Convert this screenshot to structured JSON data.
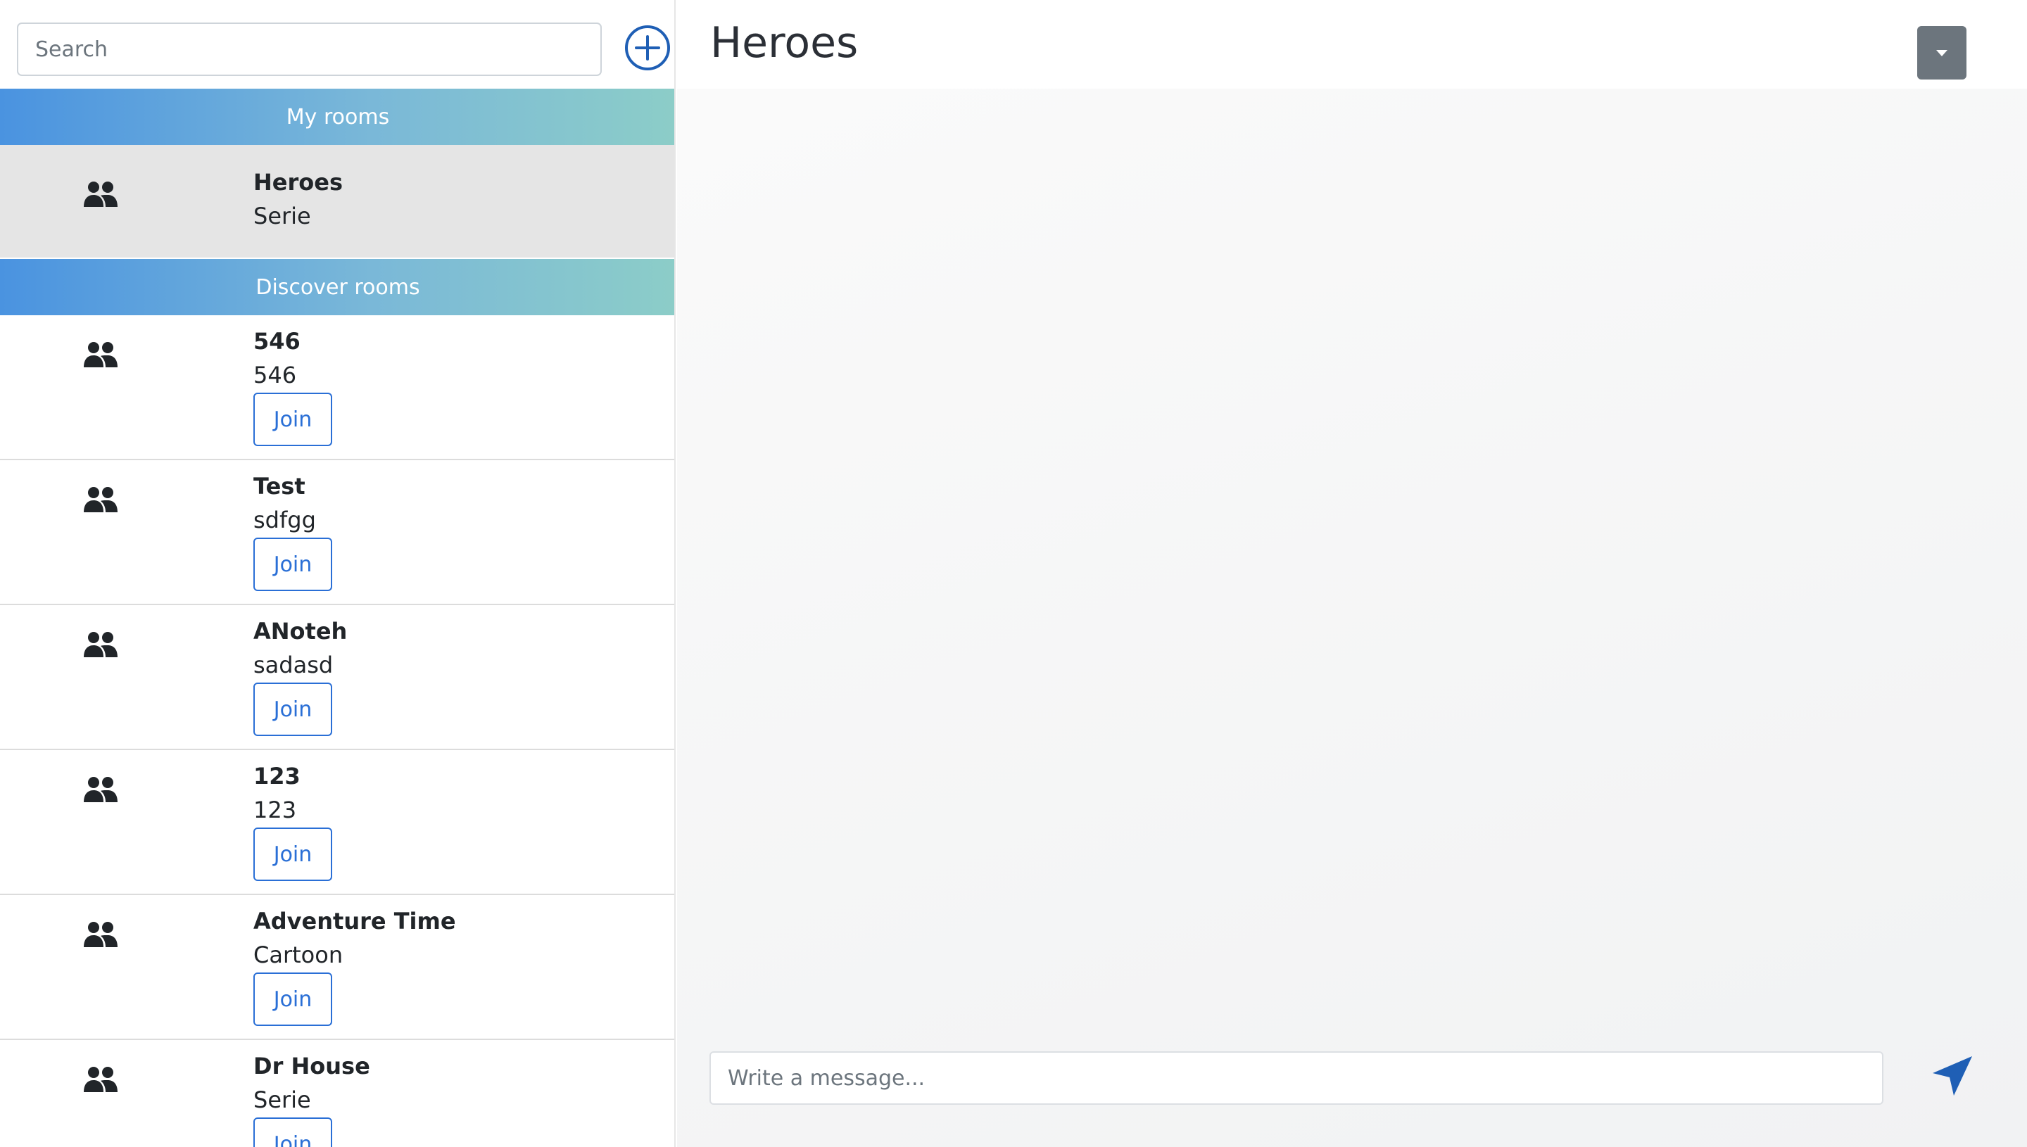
{
  "sidebar": {
    "search": {
      "placeholder": "Search",
      "value": ""
    },
    "add_button_icon": "plus-circle-icon",
    "my_rooms_label": "My rooms",
    "discover_rooms_label": "Discover rooms",
    "my_rooms": [
      {
        "name": "Heroes",
        "description": "Serie",
        "icon": "users-icon",
        "active": true
      }
    ],
    "discover_rooms": [
      {
        "name": "546",
        "description": "546",
        "join_label": "Join",
        "icon": "users-icon"
      },
      {
        "name": "Test",
        "description": "sdfgg",
        "join_label": "Join",
        "icon": "users-icon"
      },
      {
        "name": "ANoteh",
        "description": "sadasd",
        "join_label": "Join",
        "icon": "users-icon"
      },
      {
        "name": "123",
        "description": "123",
        "join_label": "Join",
        "icon": "users-icon"
      },
      {
        "name": "Adventure Time",
        "description": "Cartoon",
        "join_label": "Join",
        "icon": "users-icon"
      },
      {
        "name": "Dr House",
        "description": "Serie",
        "join_label": "Join",
        "icon": "users-icon"
      }
    ]
  },
  "main": {
    "room_title": "Heroes",
    "menu_icon": "caret-down-icon",
    "message_input": {
      "placeholder": "Write a message...",
      "value": ""
    },
    "send_icon": "send-arrow-icon"
  },
  "colors": {
    "accent_blue": "#2a6fd6",
    "header_gradient_start": "#4a93e0",
    "header_gradient_end": "#8ccdc8",
    "active_room_bg": "#e5e5e5",
    "menu_button_bg": "#6c757d"
  }
}
